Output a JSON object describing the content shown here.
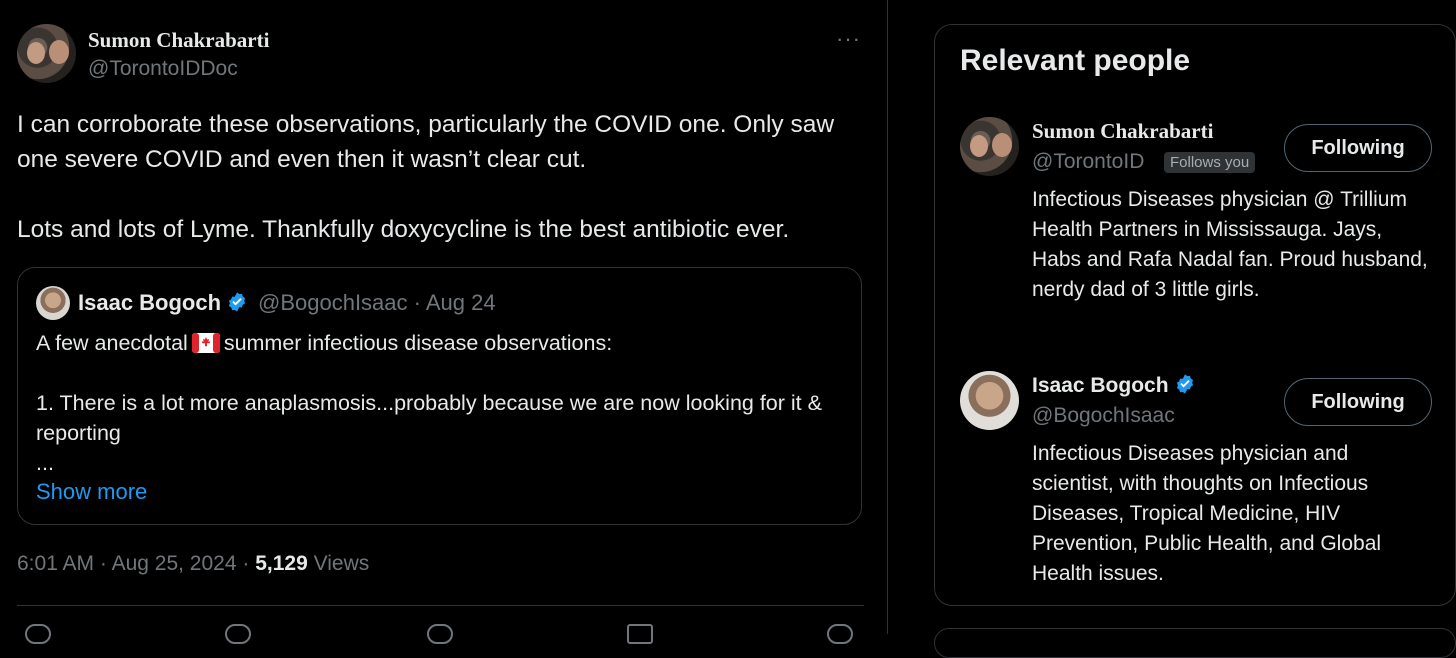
{
  "tweet": {
    "author_name": "Sumon Chakrabarti",
    "author_handle": "@TorontoIDDoc",
    "more_icon": "···",
    "text": "I can corroborate these observations, particularly the COVID one. Only saw one severe COVID and even then it wasn’t clear cut.\n\nLots and lots of Lyme. Thankfully doxycycline is the best antibiotic ever.",
    "quote": {
      "name": "Isaac Bogoch",
      "handle": "@BogochIsaac",
      "date": "Aug 24",
      "text_before_flag": "A few anecdotal",
      "text_after_flag": "summer infectious disease observations:",
      "text_rest": "1. There is a lot more anaplasmosis...probably because we are now looking for it & reporting\n...",
      "show_more": "Show more"
    },
    "time": "6:01 AM",
    "date": "Aug 25, 2024",
    "views_count": "5,129",
    "views_label": "Views"
  },
  "sidebar": {
    "title": "Relevant people",
    "people": [
      {
        "name": "Sumon Chakrabarti",
        "handle": "@TorontoID",
        "badge": "Follows you",
        "button": "Following",
        "bio": "Infectious Diseases physician @ Trillium Health Partners in Mississauga. Jays, Habs and Rafa Nadal fan. Proud husband, nerdy dad of 3 little girls."
      },
      {
        "name": "Isaac Bogoch",
        "handle": "@BogochIsaac",
        "button": "Following",
        "bio": "Infectious Diseases physician and scientist, with thoughts on Infectious Diseases, Tropical Medicine, HIV Prevention, Public Health, and Global Health issues."
      }
    ]
  },
  "colors": {
    "background": "#000000",
    "text": "#e7e9ea",
    "muted": "#71767b",
    "link": "#1d9bf0",
    "border": "#2f3336",
    "verified": "#1d9bf0"
  }
}
